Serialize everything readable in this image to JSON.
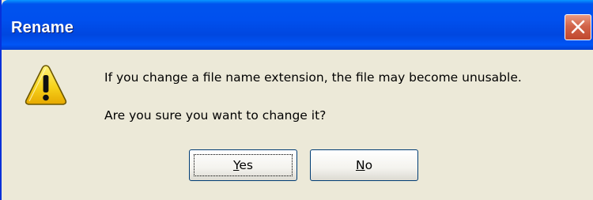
{
  "dialog": {
    "title": "Rename",
    "icon": "warning-icon",
    "message_line1": "If you change a file name extension, the file may become unusable.",
    "message_line2": "Are you sure you want to change it?"
  },
  "buttons": {
    "yes": {
      "mnemonic": "Y",
      "rest": "es"
    },
    "no": {
      "mnemonic": "N",
      "rest": "o"
    }
  },
  "colors": {
    "titlebar": "#0050ee",
    "dialog_background": "#ece9d8",
    "close_button": "#d2644a",
    "warning_yellow": "#f7d31b"
  }
}
